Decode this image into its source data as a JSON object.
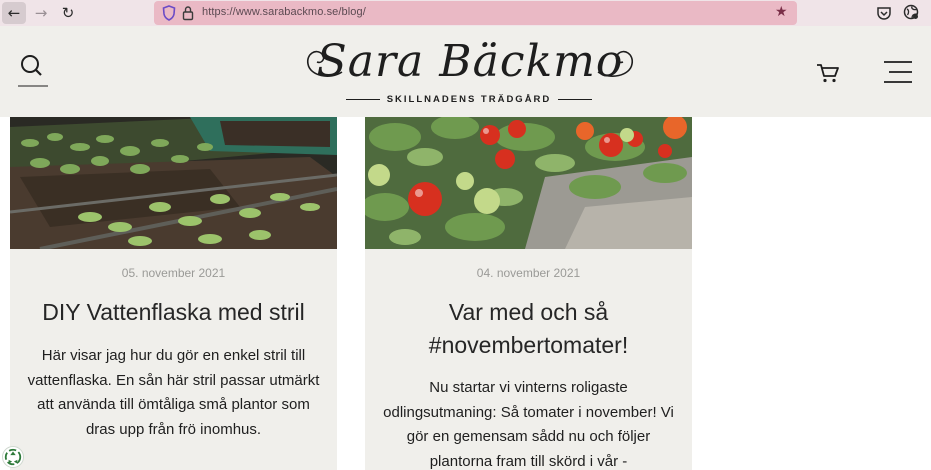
{
  "browser": {
    "url": "https://www.sarabackmo.se/blog/",
    "back_glyph": "←",
    "forward_glyph": "→",
    "reload_glyph": "↻",
    "star_glyph": "★",
    "icons": [
      "back-arrow-icon",
      "forward-arrow-icon",
      "reload-icon",
      "shield-icon",
      "lock-icon",
      "star-icon",
      "pocket-icon",
      "extension-icon"
    ]
  },
  "header": {
    "logo_title": "Sara Bäckmo",
    "logo_tagline": "SKILLNADENS TRÄDGÅRD",
    "icons": [
      "search-icon",
      "cart-icon",
      "menu-icon"
    ]
  },
  "posts": [
    {
      "date": "05. november 2021",
      "title": "DIY Vattenflaska med stril",
      "excerpt": "Här visar jag hur du gör en enkel stril till vattenflaska. En sån här stril passar utmärkt att använda till ömtåliga små plantor som dras upp från frö inomhus.",
      "image": "seedling-trays-photo"
    },
    {
      "date": "04. november 2021",
      "title": "Var med och så #novembertomater!",
      "excerpt": "Nu startar vi vinterns roligaste odlingsutmaning: Så tomater i november! Vi gör en gemensam sådd nu och följer plantorna fram till skörd i vår -",
      "image": "cherry-tomatoes-photo"
    }
  ],
  "colors": {
    "header_bg": "#f0efeb",
    "card_bg": "#f0efeb",
    "urlbar_bg": "#eab9c5",
    "chrome_bg": "#f0e4e8"
  }
}
